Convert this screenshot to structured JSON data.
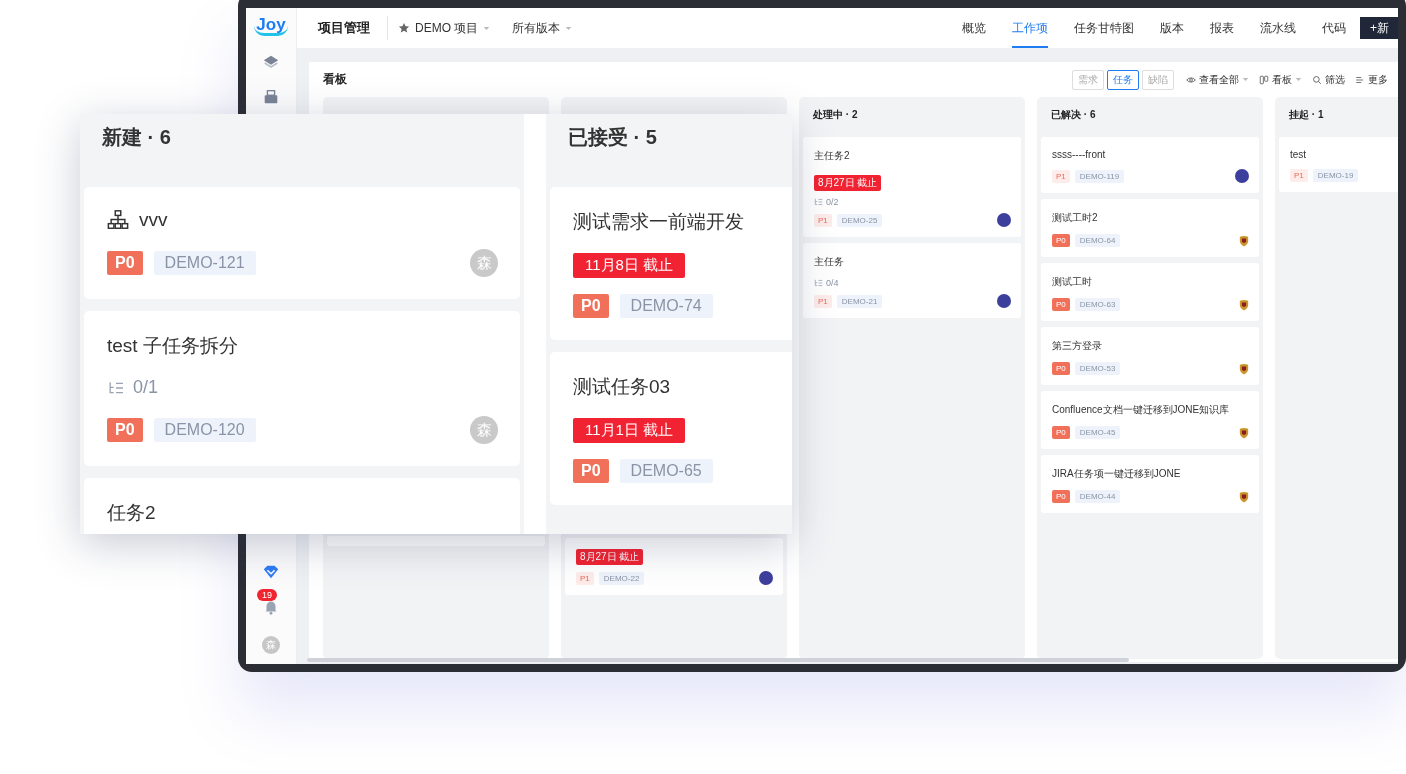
{
  "sidebar": {
    "logo": "Joy",
    "badge": "19",
    "avatar": "森"
  },
  "header": {
    "title": "项目管理",
    "project": "DEMO 项目",
    "version": "所有版本",
    "tabs": [
      {
        "label": "概览",
        "selected": false
      },
      {
        "label": "工作项",
        "selected": true
      },
      {
        "label": "任务甘特图",
        "selected": false
      },
      {
        "label": "版本",
        "selected": false
      },
      {
        "label": "报表",
        "selected": false
      },
      {
        "label": "流水线",
        "selected": false
      },
      {
        "label": "代码",
        "selected": false
      }
    ],
    "new_button": "+新"
  },
  "board": {
    "title": "看板",
    "type_filters": [
      {
        "label": "需求",
        "selected": false
      },
      {
        "label": "任务",
        "selected": true
      },
      {
        "label": "缺陷",
        "selected": false
      }
    ],
    "actions": [
      {
        "label": "查看全部",
        "kind": "eye"
      },
      {
        "label": "看板",
        "kind": "board"
      },
      {
        "label": "筛选",
        "kind": "search"
      },
      {
        "label": "更多",
        "kind": "more"
      }
    ],
    "columns": [
      {
        "cards": [
          {
            "kind": "blank"
          }
        ]
      },
      {
        "cards": [
          {
            "kind": "task",
            "due": "8月27日 截止",
            "priority": "P1",
            "urgent": false,
            "id": "DEMO-22",
            "avatar": {
              "kind": "photo"
            }
          }
        ]
      },
      {
        "title": "处理中 · 2",
        "cards": [
          {
            "kind": "task",
            "title": "主任务2",
            "due": "8月27日 截止",
            "subtasks": "0/2",
            "priority": "P1",
            "urgent": false,
            "id": "DEMO-25",
            "avatar": {
              "kind": "photo"
            }
          },
          {
            "kind": "task",
            "title": "主任务",
            "subtasks": "0/4",
            "priority": "P1",
            "urgent": false,
            "id": "DEMO-21",
            "avatar": {
              "kind": "photo"
            }
          }
        ]
      },
      {
        "title": "已解决 · 6",
        "cards": [
          {
            "kind": "task",
            "title": "ssss----front",
            "priority": "P1",
            "urgent": false,
            "id": "DEMO-119",
            "avatar": {
              "kind": "photo"
            }
          },
          {
            "kind": "task",
            "title": "测试工时2",
            "priority": "P0",
            "urgent": true,
            "id": "DEMO-64",
            "avatar": {
              "kind": "crest"
            }
          },
          {
            "kind": "task",
            "title": "测试工时",
            "priority": "P0",
            "urgent": true,
            "id": "DEMO-63",
            "avatar": {
              "kind": "crest"
            }
          },
          {
            "kind": "task",
            "title": "第三方登录",
            "priority": "P0",
            "urgent": true,
            "id": "DEMO-53",
            "avatar": {
              "kind": "crest"
            }
          },
          {
            "kind": "task",
            "title": "Confluence文档一键迁移到JONE知识库",
            "priority": "P0",
            "urgent": true,
            "id": "DEMO-45",
            "avatar": {
              "kind": "crest"
            }
          },
          {
            "kind": "task",
            "title": "JIRA任务项一键迁移到JONE",
            "priority": "P0",
            "urgent": true,
            "id": "DEMO-44",
            "avatar": {
              "kind": "crest"
            }
          }
        ]
      },
      {
        "title": "挂起 · 1",
        "cards": [
          {
            "kind": "task",
            "title": "test",
            "priority": "P1",
            "urgent": false,
            "id": "DEMO-19"
          }
        ]
      }
    ]
  },
  "zoom_panel": {
    "columns": [
      {
        "title": "新建 · 6",
        "cards": [
          {
            "kind": "parent",
            "title": "vvv",
            "priority": "P0",
            "urgent": true,
            "id": "DEMO-121",
            "avatar": {
              "kind": "initial",
              "text": "森"
            }
          },
          {
            "kind": "task",
            "title": "test 子任务拆分",
            "subtasks": "0/1",
            "priority": "P0",
            "urgent": true,
            "id": "DEMO-120",
            "avatar": {
              "kind": "initial",
              "text": "森"
            }
          },
          {
            "kind": "task",
            "title": "任务2"
          }
        ]
      },
      {
        "title": "已接受 · 5",
        "cards": [
          {
            "kind": "task",
            "title": "测试需求一前端开发",
            "due": "11月8日 截止",
            "priority": "P0",
            "urgent": true,
            "id": "DEMO-74"
          },
          {
            "kind": "task",
            "title": "测试任务03",
            "due": "11月1日 截止",
            "priority": "P0",
            "urgent": true,
            "id": "DEMO-65"
          }
        ]
      }
    ]
  }
}
